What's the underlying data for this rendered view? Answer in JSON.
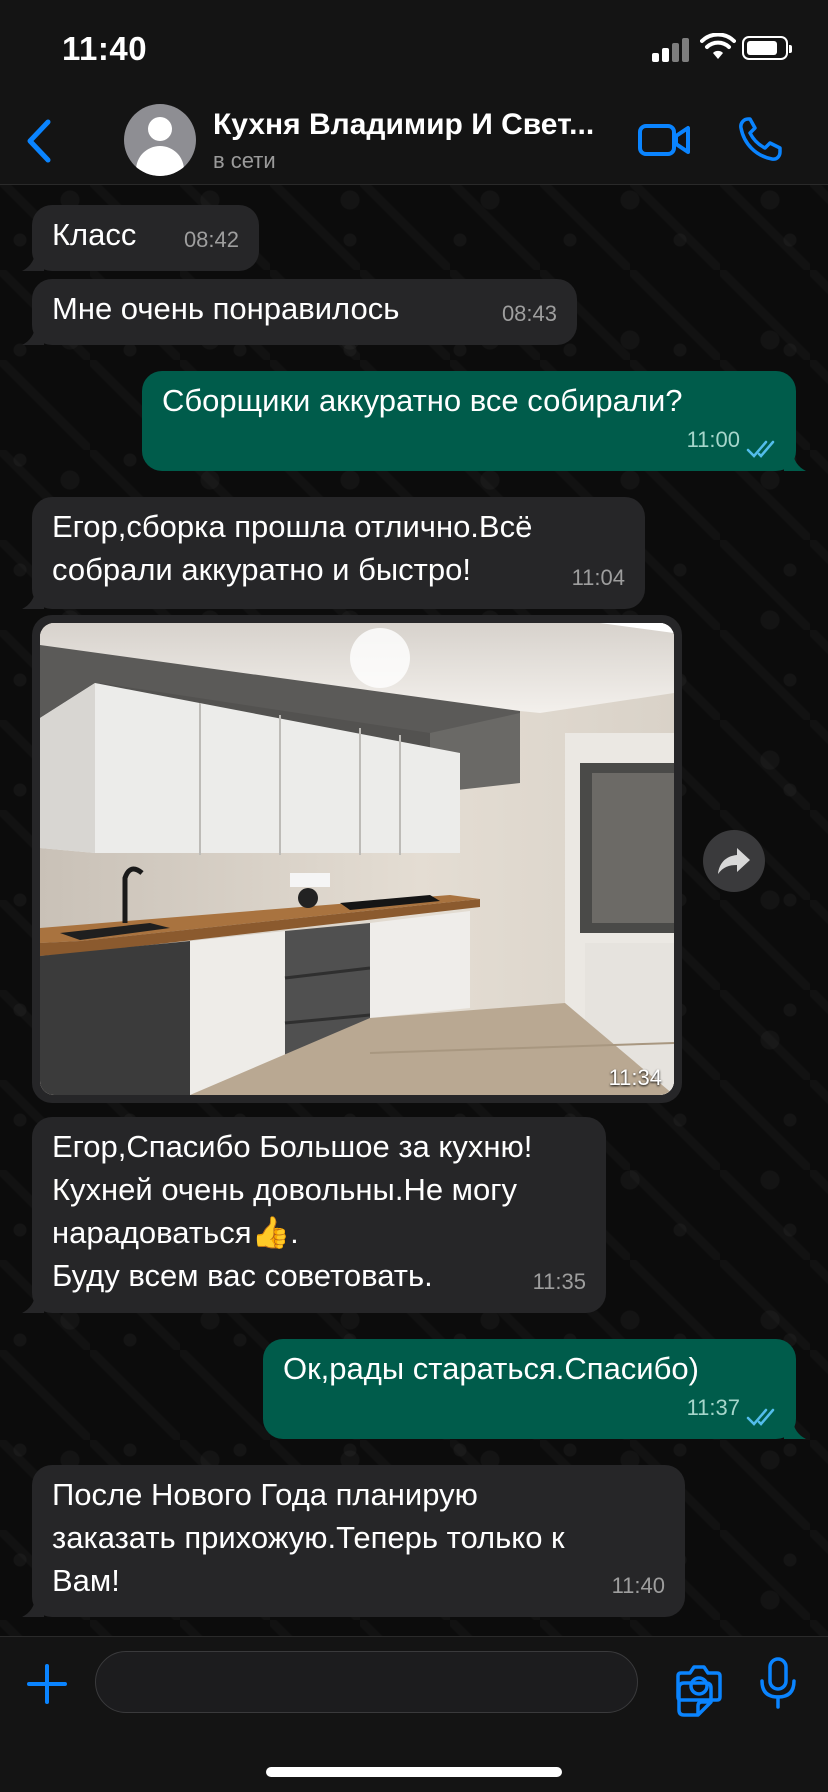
{
  "status_bar": {
    "time": "11:40"
  },
  "header": {
    "contact_name": "Кухня Владимир И Свет...",
    "presence": "в сети",
    "icons": [
      "back-chevron-icon",
      "avatar",
      "video-call-icon",
      "phone-icon"
    ],
    "accent_color": "#0a84ff"
  },
  "messages": [
    {
      "dir": "in",
      "text": "Класс",
      "time": "08:42"
    },
    {
      "dir": "in",
      "text": "Мне очень понравилось",
      "time": "08:43"
    },
    {
      "dir": "out",
      "text": "Сборщики аккуратно все собирали?",
      "time": "11:00",
      "read": true
    },
    {
      "dir": "in",
      "text": "Егор,сборка прошла отлично.Всё\nсобрали аккуратно и быстро!",
      "time": "11:04"
    },
    {
      "dir": "in",
      "type": "photo",
      "caption": "",
      "time": "11:34"
    },
    {
      "dir": "in",
      "text": "Егор,Спасибо Большое за кухню!\nКухней очень довольны.Не могу\nнарадоваться👍.\nБуду всем вас советовать.",
      "time": "11:35"
    },
    {
      "dir": "out",
      "text": "Ок,рады стараться.Спасибо)",
      "time": "11:37",
      "read": true
    },
    {
      "dir": "in",
      "text": "После Нового Года планирую\nзаказать прихожую.Теперь только к\nВам!",
      "time": "11:40"
    }
  ],
  "input_bar": {
    "placeholder": "",
    "icons": [
      "plus-icon",
      "sticker-icon",
      "camera-icon",
      "microphone-icon"
    ]
  },
  "colors": {
    "incoming_bubble": "#262628",
    "outgoing_bubble": "#005c4b",
    "read_ticks": "#53bdeb"
  }
}
